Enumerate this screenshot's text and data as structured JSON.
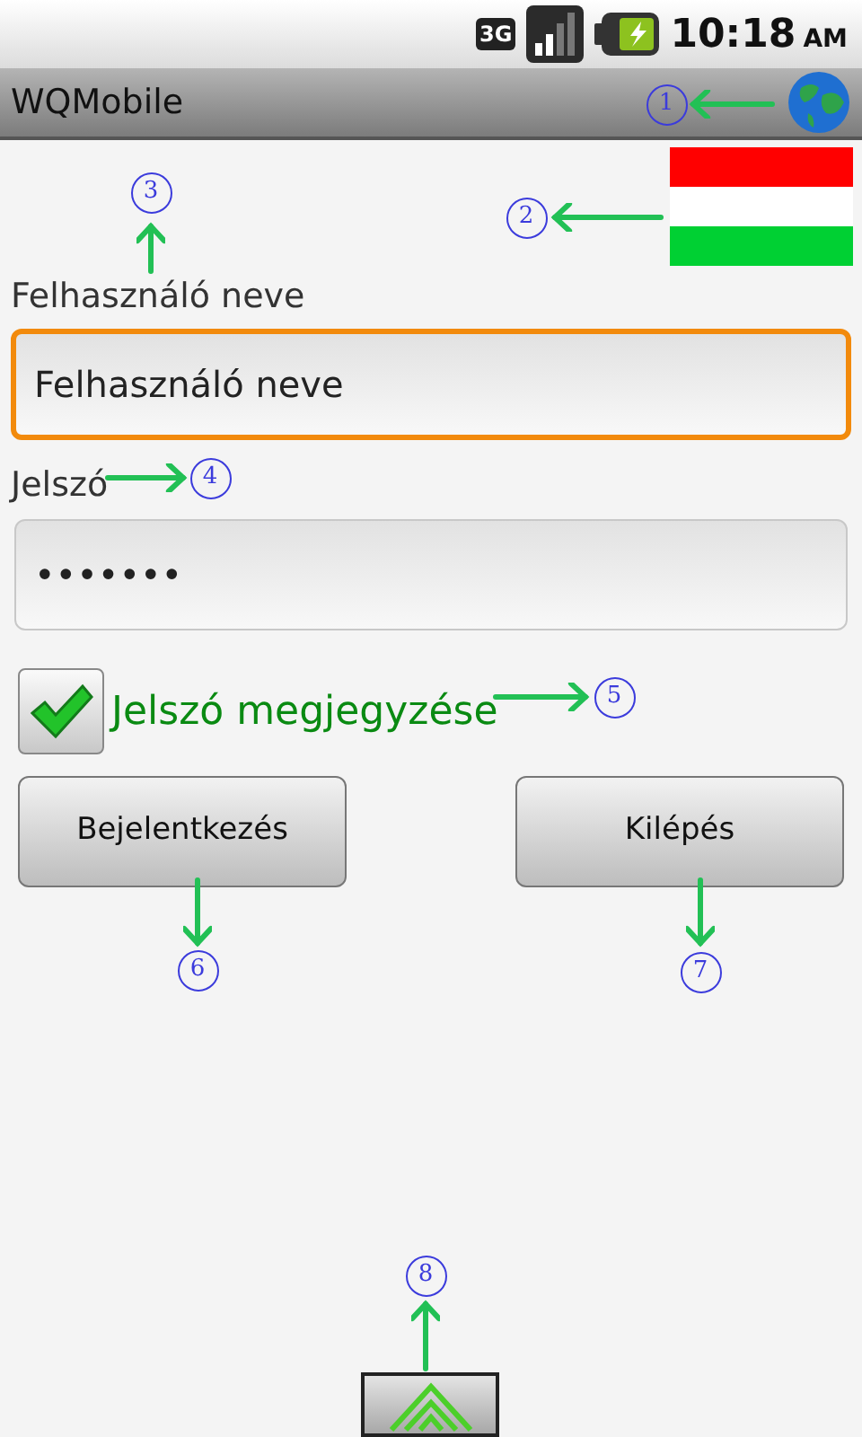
{
  "status_bar": {
    "network": "3G",
    "time": "10:18",
    "meridiem": "AM"
  },
  "app_bar": {
    "title": "WQMobile"
  },
  "username": {
    "label": "Felhasználó neve",
    "value": "Felhasználó neve",
    "focused": true
  },
  "password": {
    "label": "Jelszó",
    "value": "•••••••",
    "focused": false
  },
  "remember": {
    "label": "Jelszó megjegyzése",
    "checked": true
  },
  "buttons": [
    "Bejelentkezés",
    "Kilépés"
  ],
  "annotations": [
    {
      "number": "1"
    },
    {
      "number": "2"
    },
    {
      "number": "3"
    },
    {
      "number": "4"
    },
    {
      "number": "5"
    },
    {
      "number": "6"
    },
    {
      "number": "7"
    },
    {
      "number": "8"
    }
  ]
}
